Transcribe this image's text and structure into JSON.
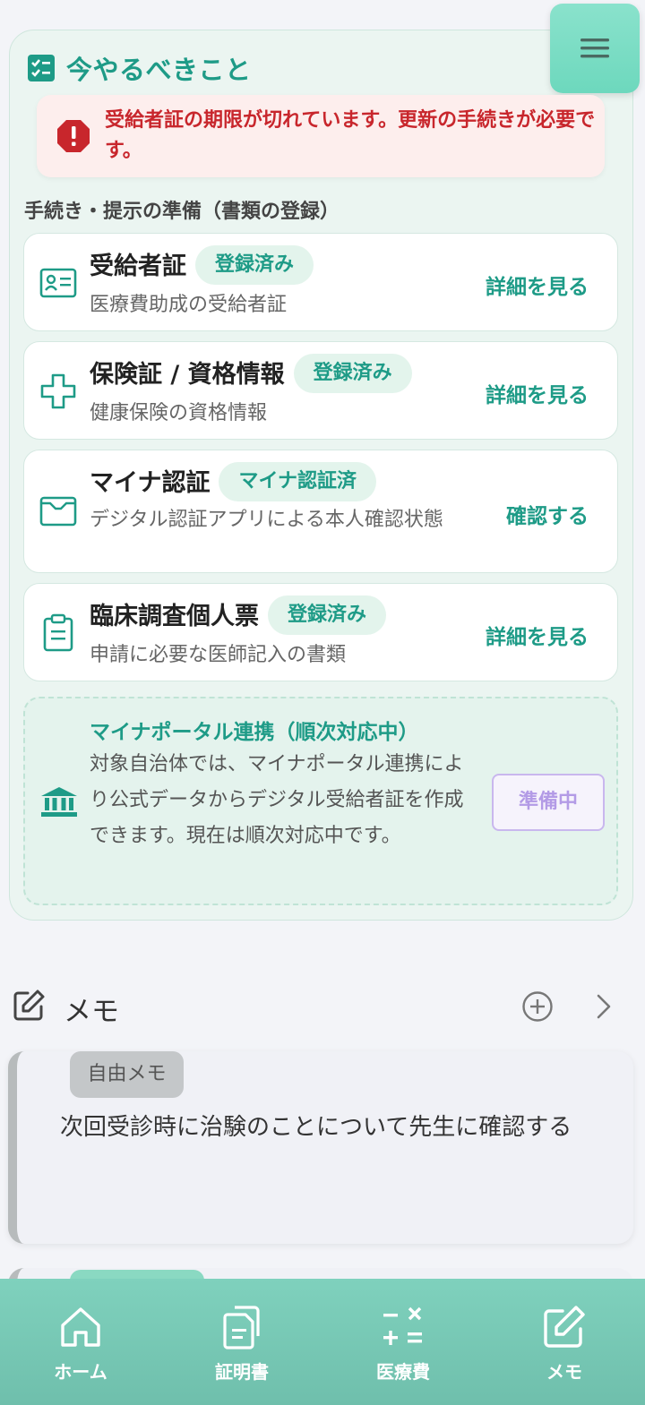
{
  "todo": {
    "title": "今やるべきこと",
    "alert": "受給者証の期限が切れています。更新の手続きが必要です。",
    "section_label": "手続き・提示の準備（書類の登録）",
    "items": [
      {
        "title": "受給者証",
        "badge": "登録済み",
        "sub": "医療費助成の受給者証",
        "action": "詳細を見る",
        "icon": "id-card-icon"
      },
      {
        "title": "保険証 / 資格情報",
        "badge": "登録済み",
        "sub": "健康保険の資格情報",
        "action": "詳細を見る",
        "icon": "medical-cross-icon"
      },
      {
        "title": "マイナ認証",
        "badge": "マイナ認証済",
        "sub": "デジタル認証アプリによる本人確認状態",
        "action": "確認する",
        "icon": "card-icon"
      },
      {
        "title": "臨床調査個人票",
        "badge": "登録済み",
        "sub": "申請に必要な医師記入の書類",
        "action": "詳細を見る",
        "icon": "clipboard-icon"
      }
    ],
    "mynaportal": {
      "title": "マイナポータル連携（順次対応中）",
      "body": "対象自治体では、マイナポータル連携により公式データからデジタル受給者証を作成できます。現在は順次対応中です。",
      "button": "準備中"
    }
  },
  "memo": {
    "title": "メモ",
    "cards": [
      {
        "tag": "自由メモ",
        "text": "次回受診時に治験のことについて先生に確認する"
      }
    ]
  },
  "nav": [
    {
      "label": "ホーム",
      "icon": "home-icon"
    },
    {
      "label": "証明書",
      "icon": "documents-icon"
    },
    {
      "label": "医療費",
      "icon": "calculator-icon"
    },
    {
      "label": "メモ",
      "icon": "edit-icon"
    }
  ],
  "colors": {
    "accent": "#1e9b87",
    "alert": "#c8262c",
    "nav_bg": "#72c3ae"
  }
}
